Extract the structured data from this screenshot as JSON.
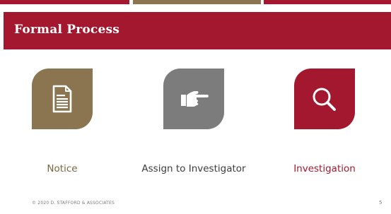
{
  "title": "Formal Process",
  "steps": [
    {
      "label": "Notice",
      "icon": "document-icon",
      "color": "#8b7550"
    },
    {
      "label": "Assign to Investigator",
      "icon": "pointing-hand-icon",
      "color": "#7c7c7c"
    },
    {
      "label": "Investigation",
      "icon": "magnifier-icon",
      "color": "#a3182e"
    }
  ],
  "footer": "© 2020 D. STAFFORD & ASSOCIATES",
  "page_number": "5",
  "colors": {
    "accent": "#a3182e",
    "gold": "#8b7550",
    "gray": "#7c7c7c"
  }
}
